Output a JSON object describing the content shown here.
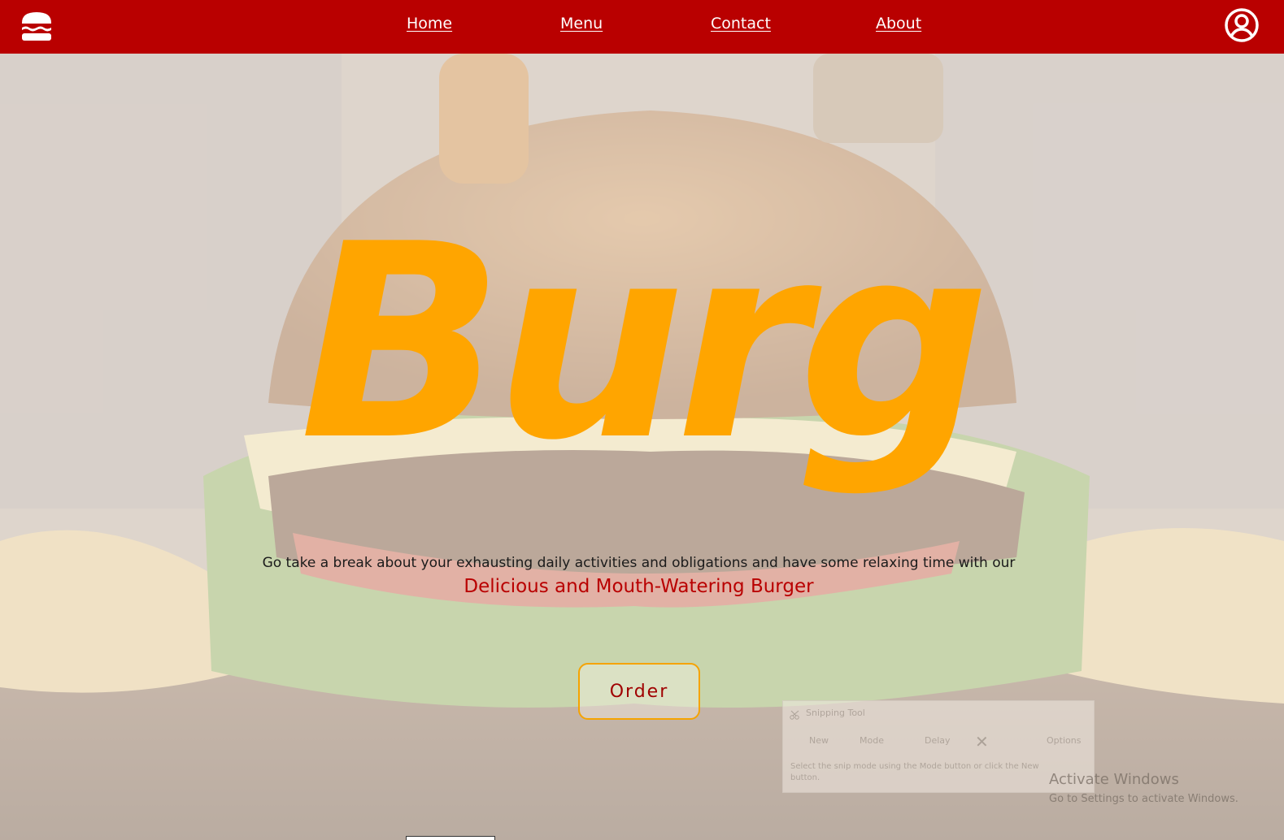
{
  "navbar": {
    "links": {
      "home": "Home",
      "menu": "Menu",
      "contact": "Contact",
      "about": "About"
    },
    "logo_icon": "burger-icon",
    "account_icon": "user-circle-icon",
    "background_color": "#b90000"
  },
  "hero": {
    "title": "Burg",
    "tagline": "Go take a break about your exhausting daily activities and obligations and have some relaxing time with our",
    "highlight": "Delicious and Mouth-Watering Burger",
    "order_button": "Order",
    "title_color": "#ffa500",
    "highlight_color": "#b90000"
  },
  "snipping_tool": {
    "title": "Snipping Tool",
    "new_label": "New",
    "mode_label": "Mode",
    "delay_label": "Delay",
    "options_label": "Options",
    "hint": "Select the snip mode using the Mode button or click the New button."
  },
  "watermark": {
    "title": "Activate Windows",
    "subtitle": "Go to Settings to activate Windows."
  }
}
